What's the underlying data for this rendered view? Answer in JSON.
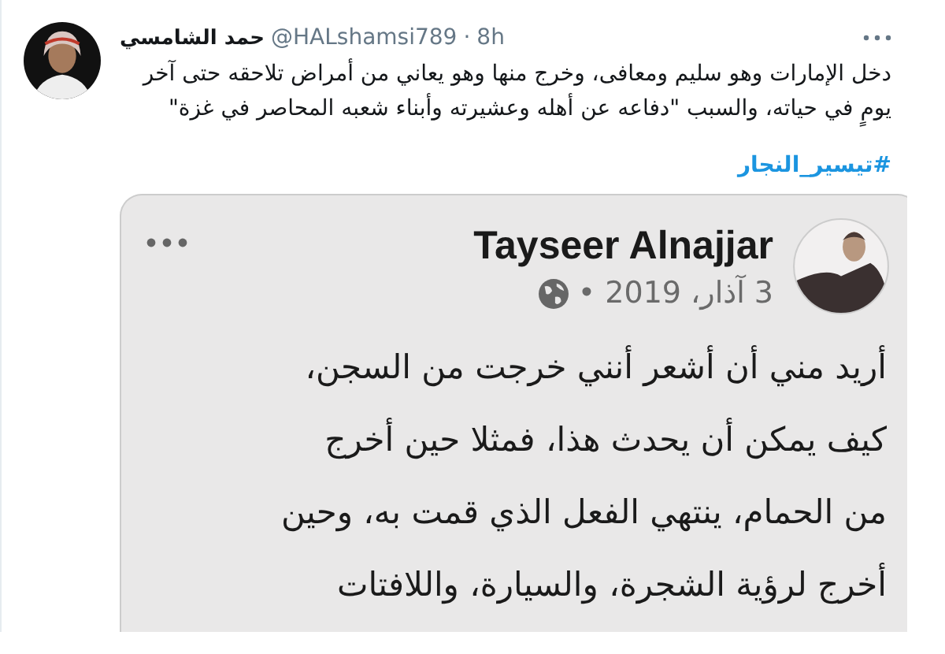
{
  "tweet": {
    "author_name": "حمد الشامسي",
    "handle": "@HALshamsi789",
    "separator": "·",
    "time": "8h",
    "text": "دخل الإمارات وهو سليم ومعافى، وخرج منها وهو يعاني من أمراض تلاحقه حتى آخر\nيومٍ في حياته، والسبب \"دفاعه عن أهله وعشيرته وأبناء شعبه المحاصر في غزة\"",
    "hashtag": "#تيسير_النجار"
  },
  "embedded_post": {
    "author_name": "Tayseer Alnajjar",
    "date": "3 آذار، 2019",
    "separator": "•",
    "text": "أريد مني أن أشعر أنني خرجت من السجن،\nكيف يمكن أن يحدث هذا،  فمثلا حين أخرج\nمن الحمام، ينتهي الفعل الذي قمت به، وحين\nأخرج لرؤية الشجرة، والسيارة، واللافتات"
  }
}
